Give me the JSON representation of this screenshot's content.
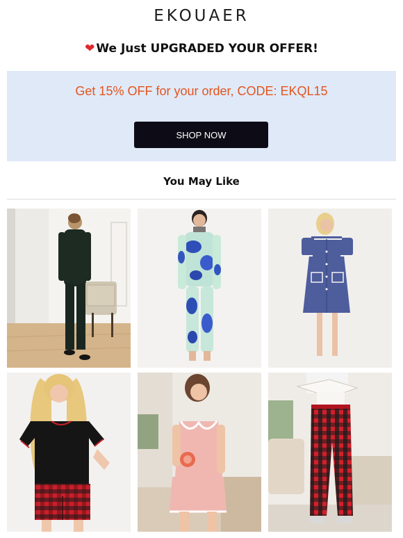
{
  "brand": {
    "logo_text": "EKOUAER"
  },
  "promo": {
    "headline": "We Just UPGRADED YOUR OFFER!",
    "offer_text": "Get 15% OFF for your order, CODE: EKQL15",
    "cta_label": "SHOP NOW",
    "accent_color": "#e2551e",
    "box_color": "#e0e9f8",
    "button_color": "#0d0b16"
  },
  "recommendations": {
    "title": "You May Like",
    "products": [
      {
        "image": "black-button-up-pajama-set-photo"
      },
      {
        "image": "blue-tie-dye-lounge-set-photo"
      },
      {
        "image": "navy-button-front-nightgown-photo"
      },
      {
        "image": "black-tee-red-plaid-shorts-set-photo"
      },
      {
        "image": "pink-satin-cami-shorts-set-photo"
      },
      {
        "image": "red-plaid-pajama-pants-photo"
      }
    ]
  }
}
